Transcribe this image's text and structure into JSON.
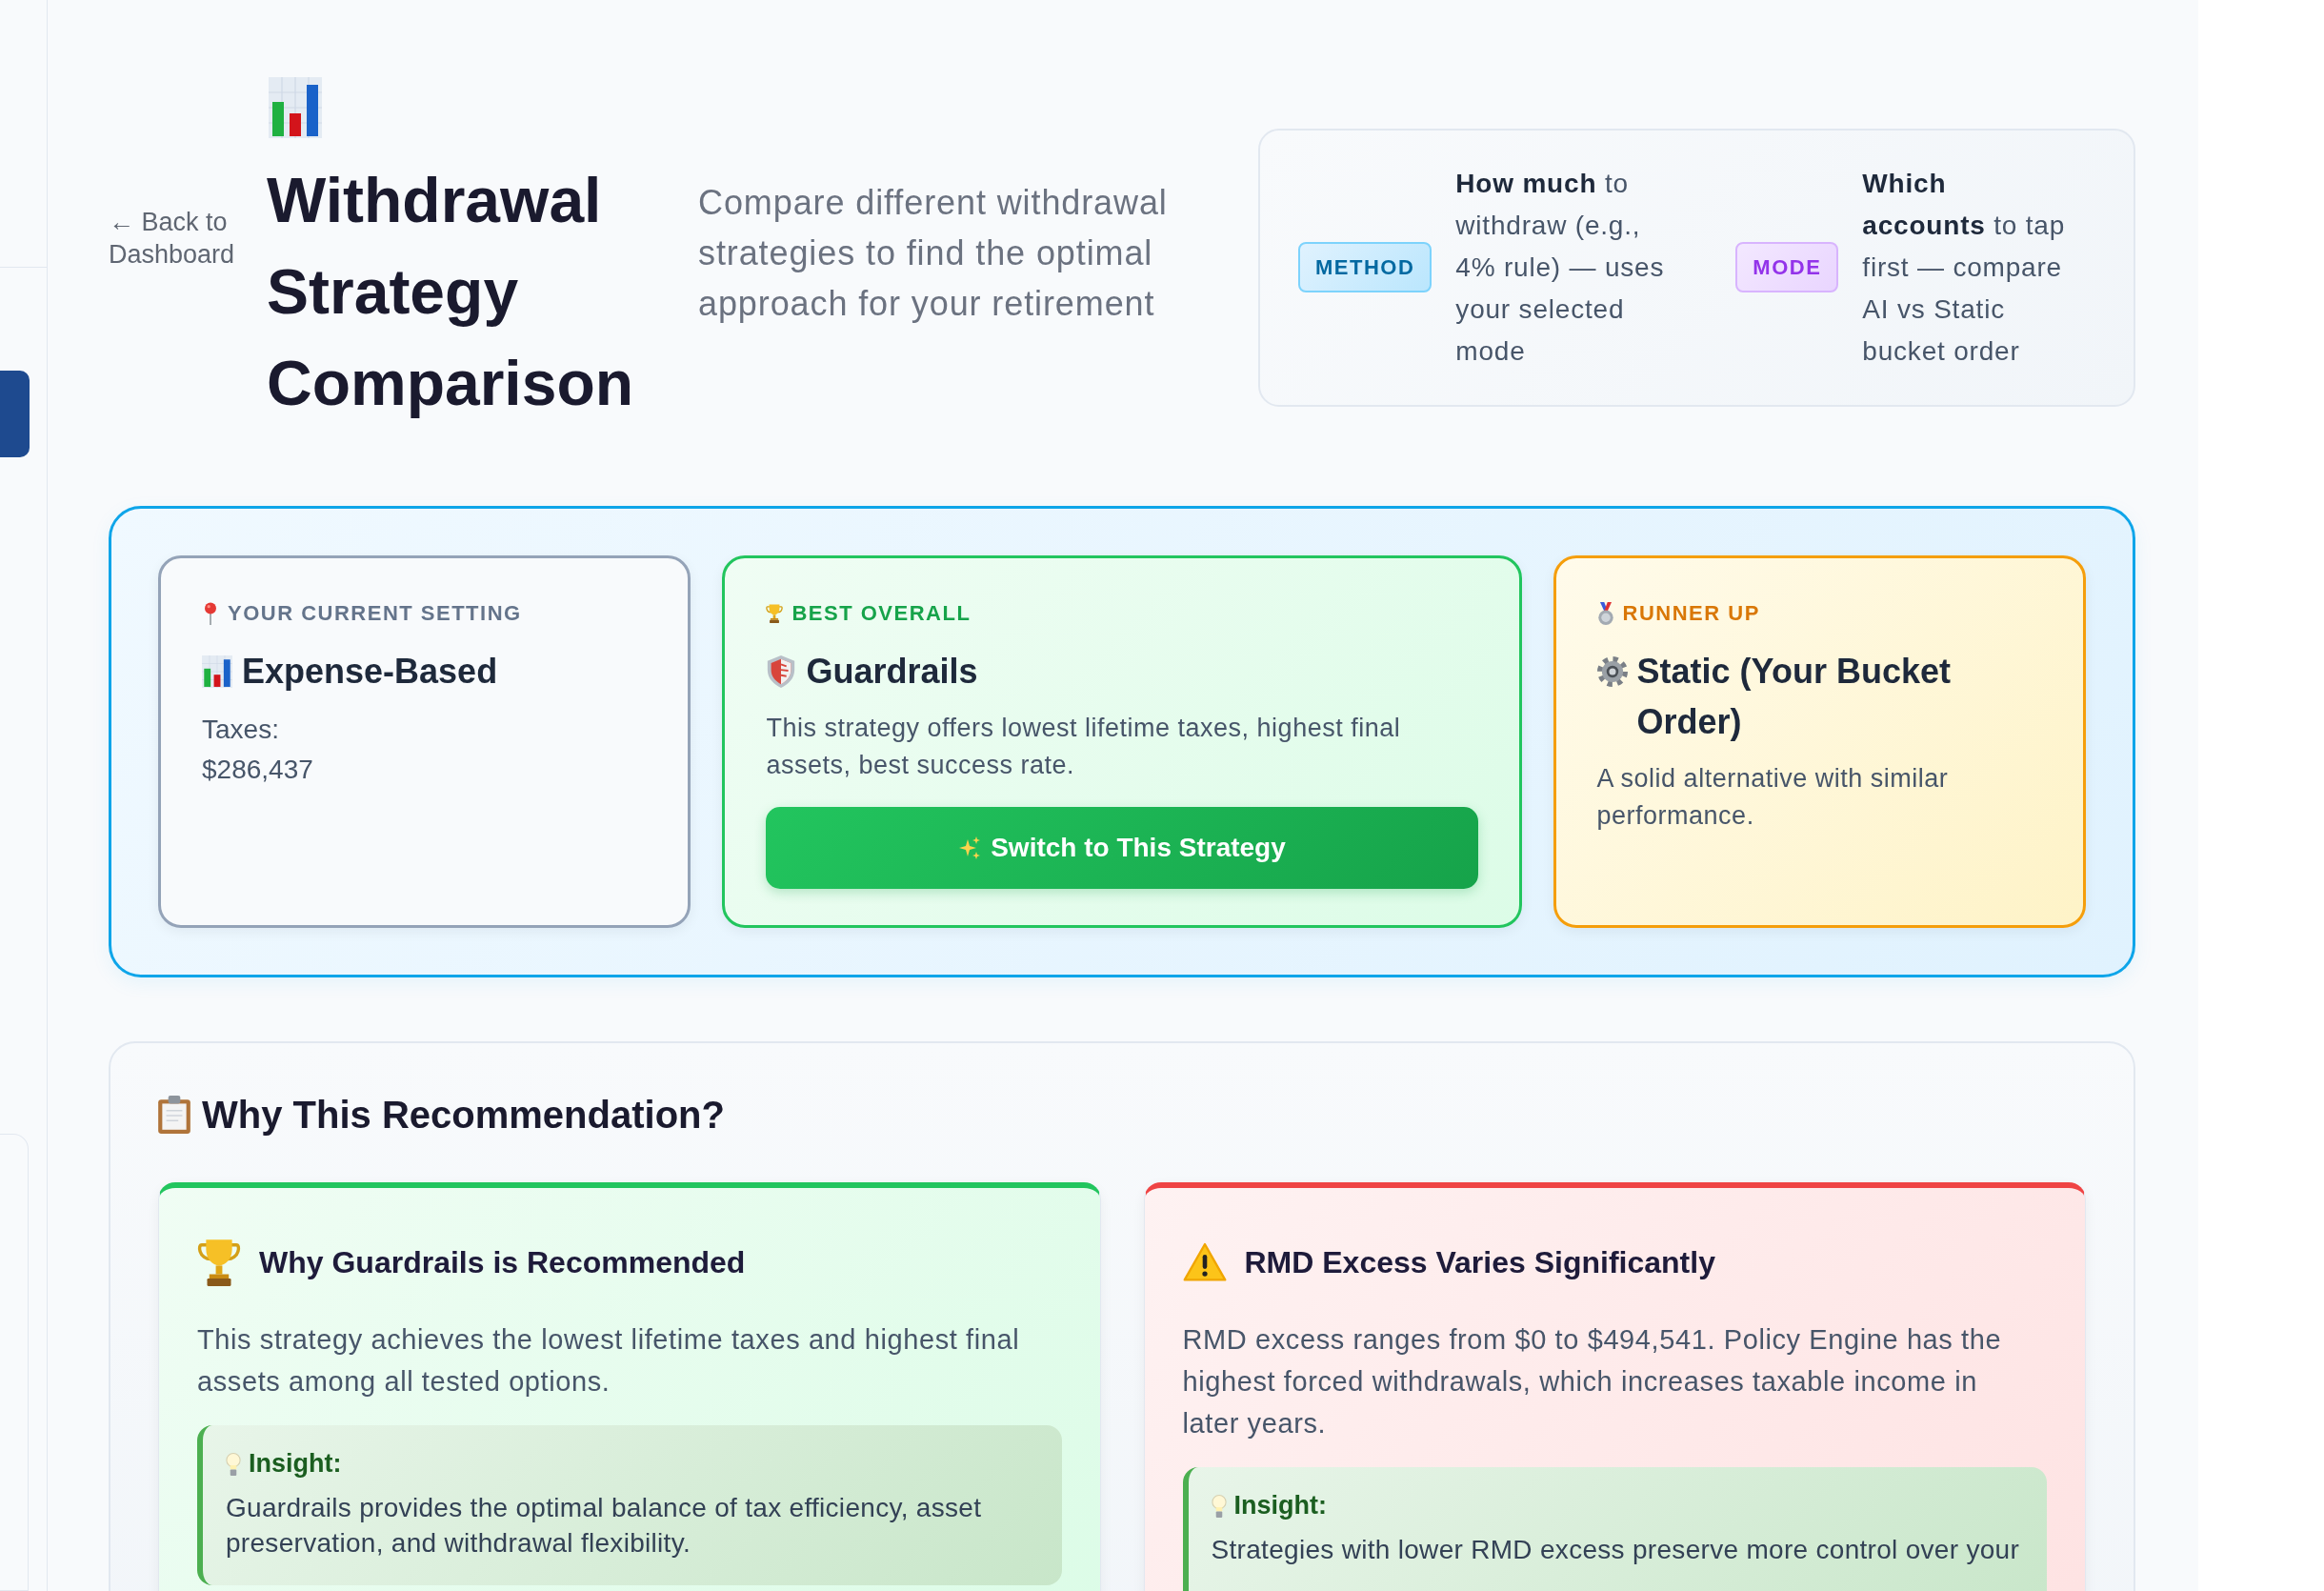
{
  "back_link": "← Back to Dashboard",
  "header": {
    "title": "Withdrawal Strategy Comparison",
    "subtitle": "Compare different withdrawal strategies to find the optimal approach for your retirement"
  },
  "legend": [
    {
      "kind": "method",
      "badge": "METHOD",
      "text": "**How much** to withdraw (e.g., 4% rule) — uses your selected mode"
    },
    {
      "kind": "mode",
      "badge": "MODE",
      "text": "**Which accounts** to tap first — compare AI vs Static bucket order"
    }
  ],
  "recommendation": {
    "cards": [
      {
        "kind": "current",
        "label": "YOUR CURRENT SETTING",
        "name": "Expense-Based",
        "stats": [
          {
            "label": "Taxes:",
            "value": "$286,437"
          }
        ]
      },
      {
        "kind": "best",
        "label": "BEST OVERALL",
        "name": "Guardrails",
        "description": "This strategy offers lowest lifetime taxes, highest final assets, best success rate.",
        "button": "Switch to This Strategy"
      },
      {
        "kind": "runner_up",
        "label": "RUNNER UP",
        "name": "Static (Your Bucket Order)",
        "description": "A solid alternative with similar performance."
      }
    ]
  },
  "why_section": {
    "title": "Why This Recommendation?",
    "reasons": [
      {
        "kind": "success",
        "title": "Why Guardrails is Recommended",
        "text": "This strategy achieves the lowest lifetime taxes and highest final assets among all tested options.",
        "insight": {
          "label": "Insight:",
          "text": "Guardrails provides the optimal balance of tax efficiency, asset preservation, and withdrawal flexibility."
        }
      },
      {
        "kind": "warning",
        "title": "RMD Excess Varies Significantly",
        "text": "RMD excess ranges from $0 to $494,541. Policy Engine has the highest forced withdrawals, which increases taxable income in later years.",
        "insight": {
          "label": "Insight:",
          "text": "Strategies with lower RMD excess preserve more control over your"
        }
      }
    ]
  }
}
